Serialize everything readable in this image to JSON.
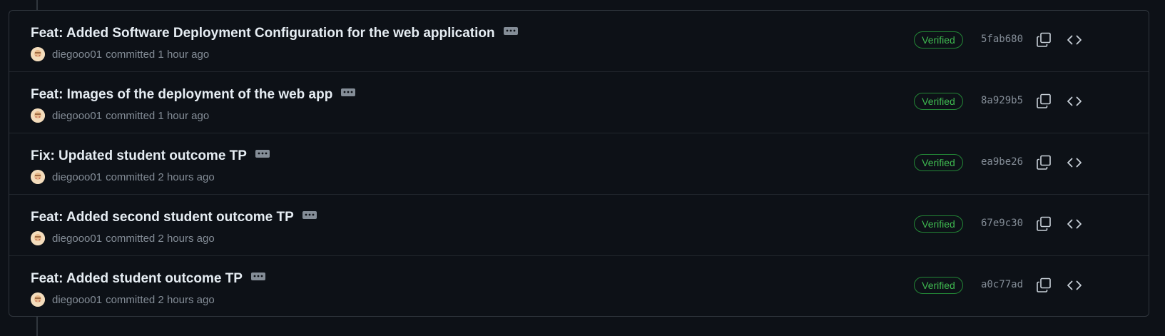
{
  "commits": [
    {
      "title": "Feat: Added Software Deployment Configuration for the web application",
      "author": "diegooo01",
      "time": "committed 1 hour ago",
      "verified": "Verified",
      "sha": "5fab680"
    },
    {
      "title": "Feat: Images of the deployment of the web app",
      "author": "diegooo01",
      "time": "committed 1 hour ago",
      "verified": "Verified",
      "sha": "8a929b5"
    },
    {
      "title": "Fix: Updated student outcome TP",
      "author": "diegooo01",
      "time": "committed 2 hours ago",
      "verified": "Verified",
      "sha": "ea9be26"
    },
    {
      "title": "Feat: Added second student outcome TP",
      "author": "diegooo01",
      "time": "committed 2 hours ago",
      "verified": "Verified",
      "sha": "67e9c30"
    },
    {
      "title": "Feat: Added student outcome TP",
      "author": "diegooo01",
      "time": "committed 2 hours ago",
      "verified": "Verified",
      "sha": "a0c77ad"
    }
  ],
  "icons": {
    "ellipsis": "kebab-horizontal-icon",
    "copy": "copy-icon",
    "browse": "code-icon"
  },
  "colors": {
    "background": "#0d1117",
    "border": "#30363d",
    "title": "#e6edf3",
    "muted": "#848d97",
    "verified": "#3fb950",
    "verified_border": "#238636"
  }
}
